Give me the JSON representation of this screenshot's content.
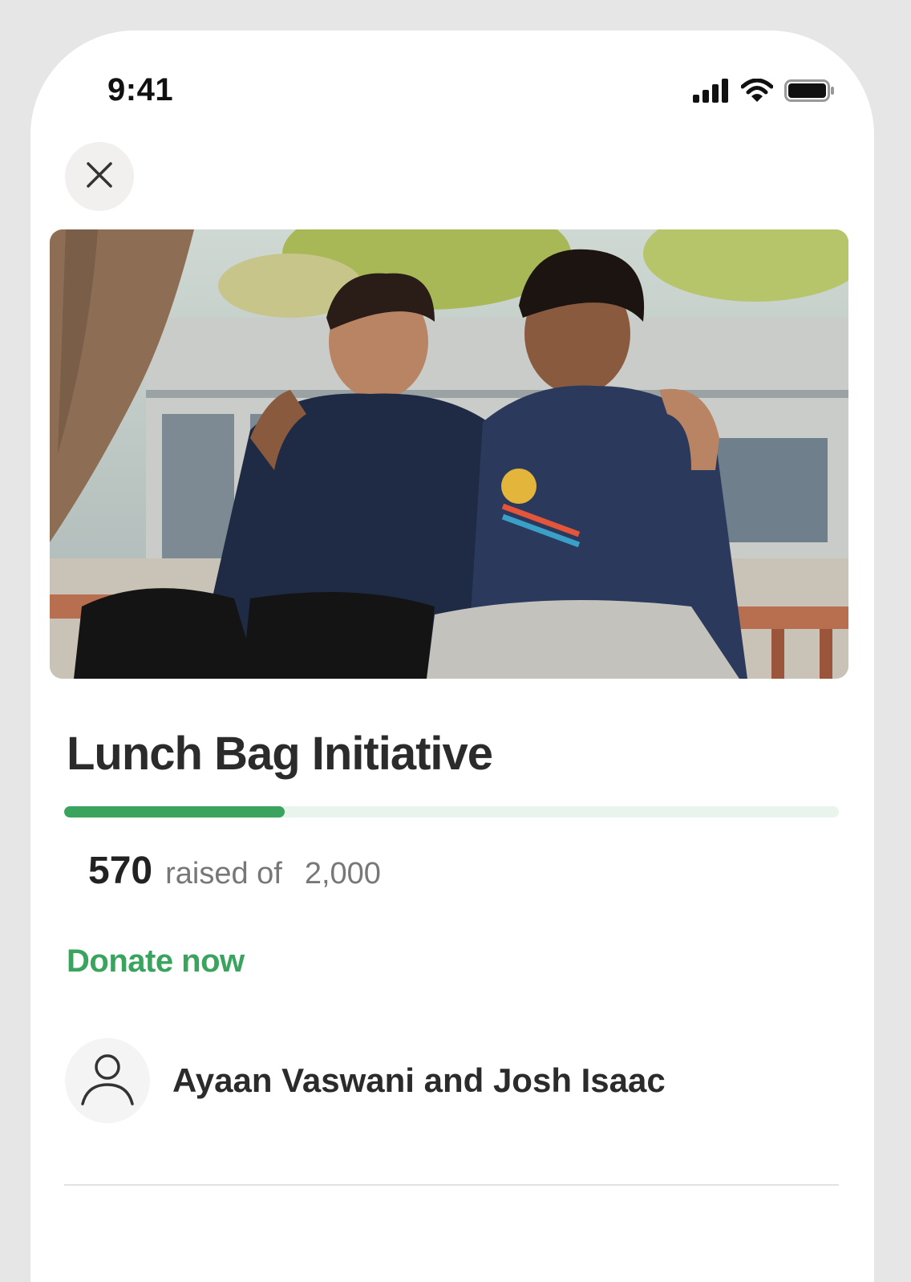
{
  "status_bar": {
    "time": "9:41"
  },
  "icons": {
    "signal": "cellular-signal-icon",
    "wifi": "wifi-icon",
    "battery": "battery-icon",
    "close": "close-icon",
    "user": "user-icon"
  },
  "campaign": {
    "title": "Lunch Bag Initiative",
    "raised_amount": "570",
    "raised_label": "raised of",
    "goal_amount": "2,000",
    "progress_fraction": 0.285,
    "donate_label": "Donate now",
    "organizers": "Ayaan Vaswani and Josh Isaac"
  },
  "colors": {
    "accent": "#3aa45e",
    "progress_track": "#e8f4ec"
  }
}
